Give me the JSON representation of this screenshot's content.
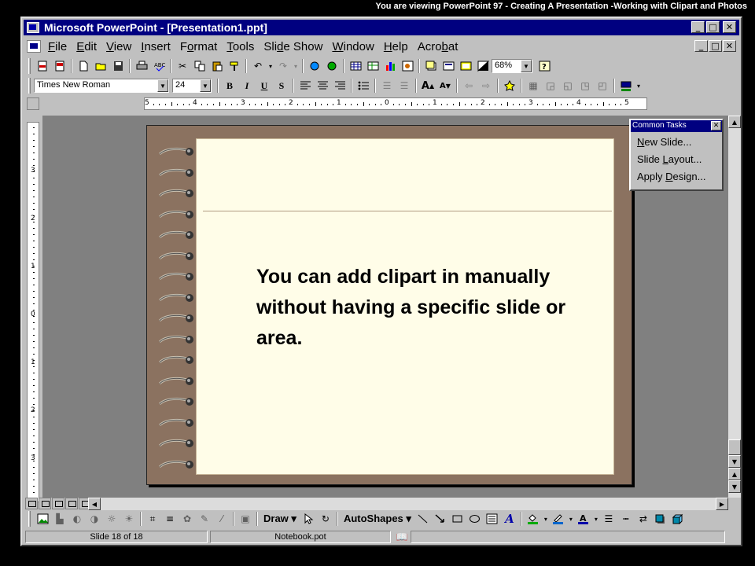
{
  "caption": "You are viewing PowerPoint 97 -  Creating A Presentation -Working with Clipart and Photos",
  "window": {
    "title": "Microsoft PowerPoint - [Presentation1.ppt]"
  },
  "title_buttons": {
    "minimize": "_",
    "maximize": "□",
    "close": "✕"
  },
  "menu": [
    {
      "pre": "",
      "key": "F",
      "post": "ile"
    },
    {
      "pre": "",
      "key": "E",
      "post": "dit"
    },
    {
      "pre": "",
      "key": "V",
      "post": "iew"
    },
    {
      "pre": "",
      "key": "I",
      "post": "nsert"
    },
    {
      "pre": "F",
      "key": "o",
      "post": "rmat"
    },
    {
      "pre": "",
      "key": "T",
      "post": "ools"
    },
    {
      "pre": "Sli",
      "key": "d",
      "post": "e Show"
    },
    {
      "pre": "",
      "key": "W",
      "post": "indow"
    },
    {
      "pre": "",
      "key": "H",
      "post": "elp"
    },
    {
      "pre": "Acro",
      "key": "b",
      "post": "at"
    }
  ],
  "toolbar": {
    "zoom": "68%"
  },
  "formatting": {
    "font": "Times New Roman",
    "size": "24",
    "bold": "B",
    "italic": "I",
    "underline": "U",
    "shadow": "S"
  },
  "ruler": {
    "h_labels": [
      "5",
      "4",
      "3",
      "2",
      "1",
      "0",
      "1",
      "2",
      "3",
      "4",
      "5"
    ],
    "v_labels": [
      "3",
      "2",
      "1",
      "0",
      "1",
      "2",
      "3"
    ]
  },
  "slide": {
    "text": "You can add clipart in manually without having a specific slide or area."
  },
  "common_tasks": {
    "title": "Common Tasks",
    "items": [
      {
        "pre": "",
        "key": "N",
        "post": "ew Slide..."
      },
      {
        "pre": "Slide ",
        "key": "L",
        "post": "ayout..."
      },
      {
        "pre": "Apply ",
        "key": "D",
        "post": "esign..."
      }
    ]
  },
  "drawing": {
    "draw": "Draw",
    "autoshapes": "AutoShapes"
  },
  "status": {
    "slide": "Slide 18 of 18",
    "template": "Notebook.pot"
  },
  "colors": {
    "title_bar": "#000080",
    "chrome": "#c0c0c0",
    "slide_frame": "#8b7260",
    "paper": "#fffde8"
  },
  "icons": [
    "document-icon",
    "pdf-icon",
    "new-icon",
    "open-icon",
    "save-icon",
    "print-icon",
    "cut-icon",
    "copy-icon",
    "paste-icon",
    "undo-icon",
    "redo-icon",
    "chart-icon",
    "help-icon",
    "bullet-icon",
    "align-left-icon",
    "select-icon",
    "line-icon",
    "arrow-icon",
    "rectangle-icon",
    "oval-icon",
    "textbox-icon",
    "fill-color-icon",
    "font-color-icon"
  ]
}
